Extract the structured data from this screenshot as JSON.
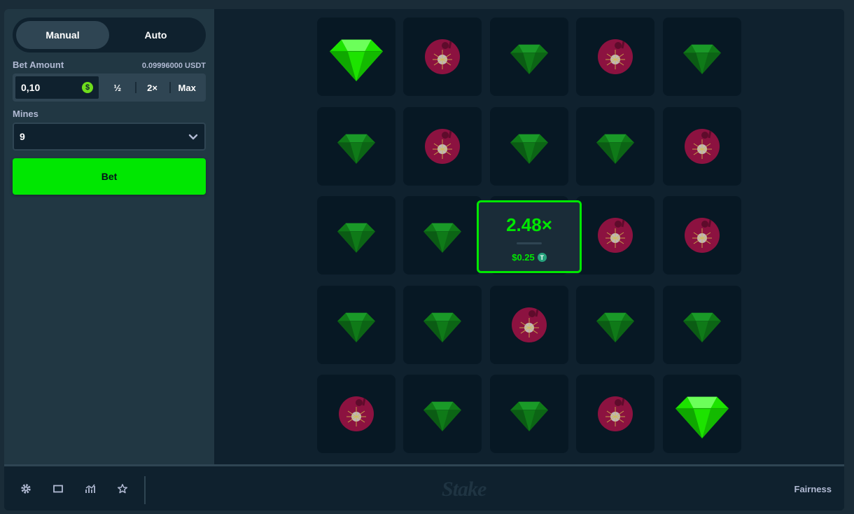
{
  "controls": {
    "modes": [
      "Manual",
      "Auto"
    ],
    "active_mode": "Manual",
    "bet_amount_label": "Bet Amount",
    "balance": "0.09996000 USDT",
    "bet_value": "0,10",
    "currency_symbol": "$",
    "half_label": "½",
    "double_label": "2×",
    "max_label": "Max",
    "mines_label": "Mines",
    "mines_value": "9",
    "bet_button_label": "Bet"
  },
  "board": {
    "rows": 5,
    "cols": 5,
    "tiles": [
      "gem-revealed",
      "mine",
      "gem",
      "mine",
      "gem",
      "gem",
      "mine",
      "gem",
      "gem",
      "mine",
      "gem",
      "gem",
      "gem",
      "mine",
      "mine",
      "gem",
      "gem",
      "mine",
      "gem",
      "gem",
      "mine",
      "gem",
      "gem",
      "mine",
      "gem-revealed"
    ],
    "colors": {
      "gem_bright": "#1de300",
      "gem_dim": "#0f7a18",
      "mine": "#8c1240",
      "accent": "#00e701"
    }
  },
  "result": {
    "multiplier": "2.48×",
    "payout": "$0.25",
    "currency_icon": "T"
  },
  "footer": {
    "icons": [
      "gear-icon",
      "theatre-icon",
      "stats-icon",
      "star-icon"
    ],
    "logo": "Stake",
    "fairness_label": "Fairness"
  }
}
